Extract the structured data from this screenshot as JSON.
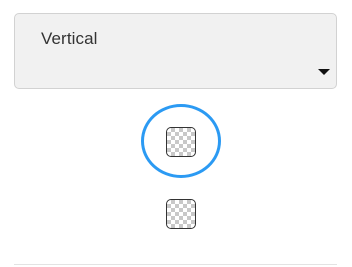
{
  "orientation_select": {
    "selected_value": "Vertical",
    "icon": "chevron-down-icon"
  },
  "swatches": [
    {
      "pattern": "transparent-checkerboard",
      "selected": true
    },
    {
      "pattern": "transparent-checkerboard",
      "selected": false
    }
  ],
  "colors": {
    "selection_ring": "#2b9af3",
    "select_background": "#f1f1f1",
    "swatch_border": "#333333"
  }
}
